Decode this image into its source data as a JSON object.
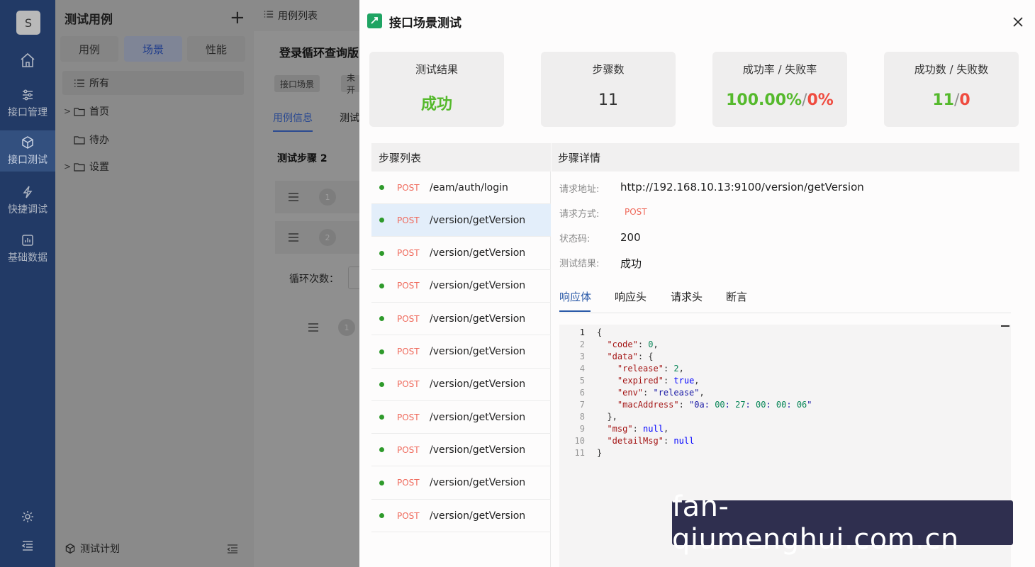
{
  "nav": {
    "avatar_letter": "S",
    "items": [
      {
        "label": "接口管理",
        "icon": "sliders-icon"
      },
      {
        "label": "接口测试",
        "icon": "cube-icon"
      },
      {
        "label": "快捷调试",
        "icon": "bolt-icon"
      },
      {
        "label": "基础数据",
        "icon": "chart-box-icon"
      }
    ],
    "active_index": 1
  },
  "tree": {
    "title": "测试用例",
    "add_label": "+",
    "segments": [
      "用例",
      "场景",
      "性能"
    ],
    "active_segment": 1,
    "items": [
      {
        "label": "所有",
        "arrow": "",
        "icon": "list-icon"
      },
      {
        "label": "首页",
        "arrow": ">",
        "icon": "folder-icon"
      },
      {
        "label": "待办",
        "arrow": "",
        "icon": "folder-icon"
      },
      {
        "label": "设置",
        "arrow": ">",
        "icon": "folder-icon"
      }
    ],
    "footer_label": "测试计划"
  },
  "background": {
    "top_tab": "用例列表",
    "heading": "登录循环查询版",
    "tags": [
      "接口场景",
      "未开"
    ],
    "tabs": [
      "用例信息",
      "测试"
    ],
    "step_title": "测试步骤 2",
    "nums": [
      "1",
      "2",
      "1"
    ],
    "loop_label": "循环次数："
  },
  "drawer": {
    "title": "接口场景测试",
    "stats": [
      {
        "label": "测试结果",
        "value": "成功"
      },
      {
        "label": "步骤数",
        "value": "11"
      },
      {
        "label": "成功率 / 失败率",
        "success": "100.00%",
        "sep": "/",
        "fail": "0%"
      },
      {
        "label": "成功数 / 失败数",
        "success": "11",
        "sep": "/",
        "fail": "0"
      }
    ],
    "steps_header": "步骤列表",
    "steps": [
      {
        "method": "POST",
        "path": "/eam/auth/login"
      },
      {
        "method": "POST",
        "path": "/version/getVersion"
      },
      {
        "method": "POST",
        "path": "/version/getVersion"
      },
      {
        "method": "POST",
        "path": "/version/getVersion"
      },
      {
        "method": "POST",
        "path": "/version/getVersion"
      },
      {
        "method": "POST",
        "path": "/version/getVersion"
      },
      {
        "method": "POST",
        "path": "/version/getVersion"
      },
      {
        "method": "POST",
        "path": "/version/getVersion"
      },
      {
        "method": "POST",
        "path": "/version/getVersion"
      },
      {
        "method": "POST",
        "path": "/version/getVersion"
      },
      {
        "method": "POST",
        "path": "/version/getVersion"
      }
    ],
    "selected_step": 1,
    "detail": {
      "header": "步骤详情",
      "url_label": "请求地址:",
      "url": "http://192.168.10.13:9100/version/getVersion",
      "method_label": "请求方式:",
      "method": "POST",
      "status_label": "状态码:",
      "status": "200",
      "result_label": "测试结果:",
      "result": "成功",
      "tabs": [
        "响应体",
        "响应头",
        "请求头",
        "断言"
      ],
      "active_tab": 0,
      "code_lines": [
        "{",
        "  \"code\": 0,",
        "  \"data\": {",
        "    \"release\": 2,",
        "    \"expired\": true,",
        "    \"env\": \"release\",",
        "    \"macAddress\": \"0a:00:27:00:00:06\"",
        "  },",
        "  \"msg\": null,",
        "  \"detailMsg\": null",
        "}"
      ]
    }
  },
  "watermark": "fan-qiumenghui.com.cn",
  "colors": {
    "success": "#55b92c",
    "fail": "#ef4b3f",
    "nav_bg": "#223a66",
    "accent": "#2b5aa8"
  }
}
